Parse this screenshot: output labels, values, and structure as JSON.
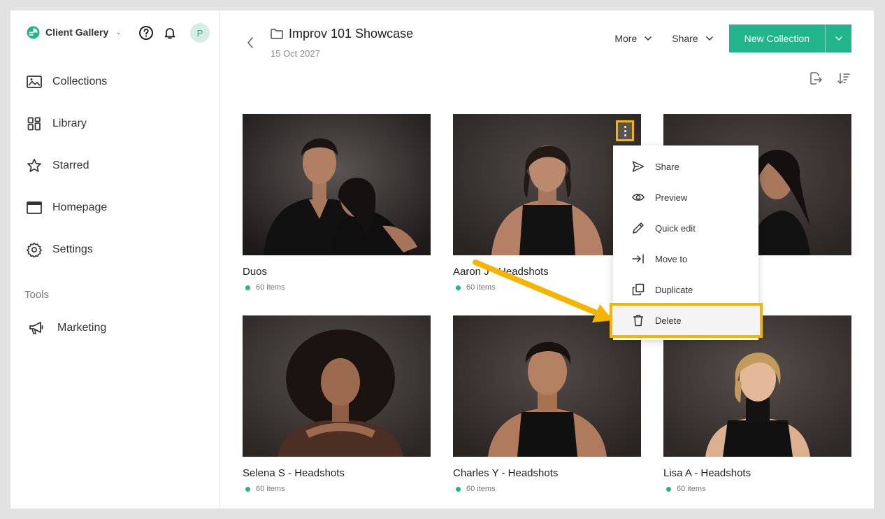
{
  "sidebar": {
    "brand": "Client Gallery",
    "avatar_initial": "P",
    "nav": [
      {
        "label": "Collections",
        "icon": "collections-icon"
      },
      {
        "label": "Library",
        "icon": "library-icon"
      },
      {
        "label": "Starred",
        "icon": "star-icon"
      },
      {
        "label": "Homepage",
        "icon": "homepage-icon"
      },
      {
        "label": "Settings",
        "icon": "gear-icon"
      }
    ],
    "tools_label": "Tools",
    "tools": [
      {
        "label": "Marketing",
        "icon": "megaphone-icon"
      }
    ]
  },
  "header": {
    "title": "Improv 101 Showcase",
    "date": "15 Oct 2027",
    "more_label": "More",
    "share_label": "Share",
    "new_collection_label": "New Collection"
  },
  "cards": [
    {
      "name": "Duos",
      "count": "60 items"
    },
    {
      "name": "Aaron J - Headshots",
      "count": "60 items"
    },
    {
      "name": "",
      "count": ""
    },
    {
      "name": "Selena S - Headshots",
      "count": "60 items"
    },
    {
      "name": "Charles Y - Headshots",
      "count": "60 items"
    },
    {
      "name": "Lisa A - Headshots",
      "count": "60 items"
    }
  ],
  "context_menu": {
    "items": [
      {
        "label": "Share",
        "icon": "send-icon"
      },
      {
        "label": "Preview",
        "icon": "eye-icon"
      },
      {
        "label": "Quick edit",
        "icon": "pencil-icon"
      },
      {
        "label": "Move to",
        "icon": "move-to-icon"
      },
      {
        "label": "Duplicate",
        "icon": "duplicate-icon"
      },
      {
        "label": "Delete",
        "icon": "trash-icon"
      }
    ],
    "highlighted": "Delete"
  },
  "colors": {
    "accent": "#22b48b",
    "highlight": "#f4b400",
    "photo_backdrop": "#3b3533"
  }
}
